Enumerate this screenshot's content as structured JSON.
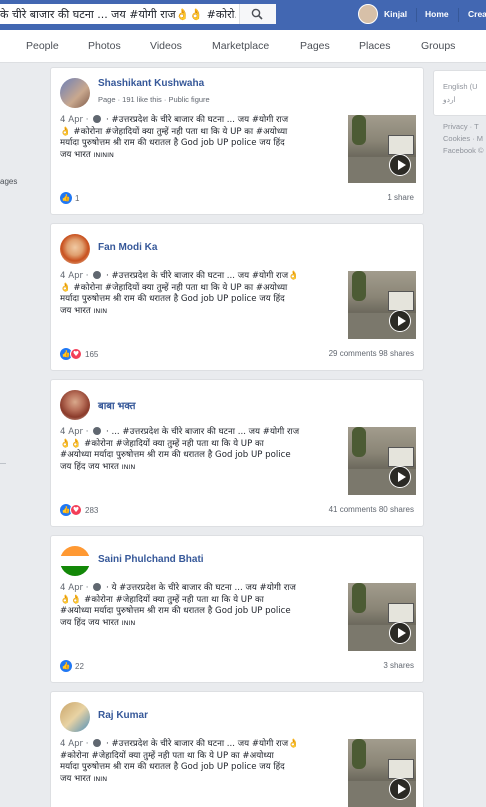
{
  "search": {
    "query": "के चीरे बाजार की घटना ... जय #योगी राज👌👌 #कोरो..."
  },
  "header": {
    "profile_name": "Kinjal",
    "home": "Home",
    "create": "Crea"
  },
  "tabs": [
    "People",
    "Photos",
    "Videos",
    "Marketplace",
    "Pages",
    "Places",
    "Groups"
  ],
  "left": {
    "fragment": "ages"
  },
  "right": {
    "lang_primary": "English (U",
    "lang_secondary": "اردو",
    "footer_1": "Privacy · T",
    "footer_2": "Cookies · M",
    "footer_3": "Facebook ©"
  },
  "colors": {
    "brand": "#4267b2",
    "link": "#365899",
    "like": "#2078f4",
    "love": "#f33e58"
  },
  "posts": [
    {
      "name": "Shashikant Kushwaha",
      "subtitle": "Page · 191 like this · Public figure",
      "date": "4 Apr · ",
      "line1": "#उत्तरप्रदेश के चीरे बाजार की घटना ... जय #योगी राज",
      "line2": "👌 #कोरोना #जेहादियों क्या तुम्हें नही पता था कि ये UP का #अयोध्या",
      "line3": "मर्यादा पुरुषोत्तम श्री राम की धरातल है God job UP police जय हिंद",
      "line4": "जय भारत ",
      "suffix": "INININ",
      "reactions": "1",
      "comments": "",
      "shares": "1 share"
    },
    {
      "name": "Fan Modi Ka",
      "subtitle": "",
      "date": "4 Apr · ",
      "line1": "#उत्तरप्रदेश के चीरे बाजार की घटना ... जय #योगी राज👌",
      "line2": "👌 #कोरोना #जेहादियों क्या तुम्हें नही पता था कि ये UP का #अयोध्या",
      "line3": "मर्यादा पुरुषोत्तम श्री राम की धरातल है God job UP police जय हिंद",
      "line4": "जय भारत ",
      "suffix": "ININ",
      "reactions": "165",
      "comments": "29 comments",
      "shares": "98 shares"
    },
    {
      "name": "बाबा भक्त",
      "subtitle": "",
      "date": "4 Apr · ",
      "line1": "... #उत्तरप्रदेश के चीरे बाजार की घटना ... जय #योगी राज",
      "line2": "👌👌 #कोरोना #जेहादियों क्या तुम्हें नही पता था कि ये UP का",
      "line3": "#अयोध्या मर्यादा पुरुषोत्तम श्री राम की धरातल है God job UP police",
      "line4": "जय हिंद जय भारत ",
      "suffix": "ININ",
      "reactions": "283",
      "comments": "41 comments",
      "shares": "80 shares"
    },
    {
      "name": "Saini Phulchand Bhati",
      "subtitle": "",
      "date": "4 Apr · ",
      "line1": "ये #उत्तरप्रदेश के चीरे बाजार की घटना ... जय #योगी राज",
      "line2": "👌👌 #कोरोना #जेहादियों क्या तुम्हें नही पता था कि ये UP का",
      "line3": "#अयोध्या मर्यादा पुरुषोत्तम श्री राम की धरातल है God job UP police",
      "line4": "जय हिंद जय भारत ",
      "suffix": "ININ",
      "reactions": "22",
      "comments": "",
      "shares": "3 shares"
    },
    {
      "name": "Raj Kumar",
      "subtitle": "",
      "date": "4 Apr · ",
      "line1": "#उत्तरप्रदेश के चीरे बाजार की घटना ... जय #योगी राज👌",
      "line2": "#कोरोना #जेहादियों क्या तुम्हें नही पता था कि ये UP का #अयोध्या",
      "line3": "मर्यादा पुरुषोत्तम श्री राम की धरातल है God job UP police जय हिंद",
      "line4": "जय भारत ",
      "suffix": "ININ",
      "reactions": "",
      "comments": "",
      "shares": ""
    }
  ]
}
